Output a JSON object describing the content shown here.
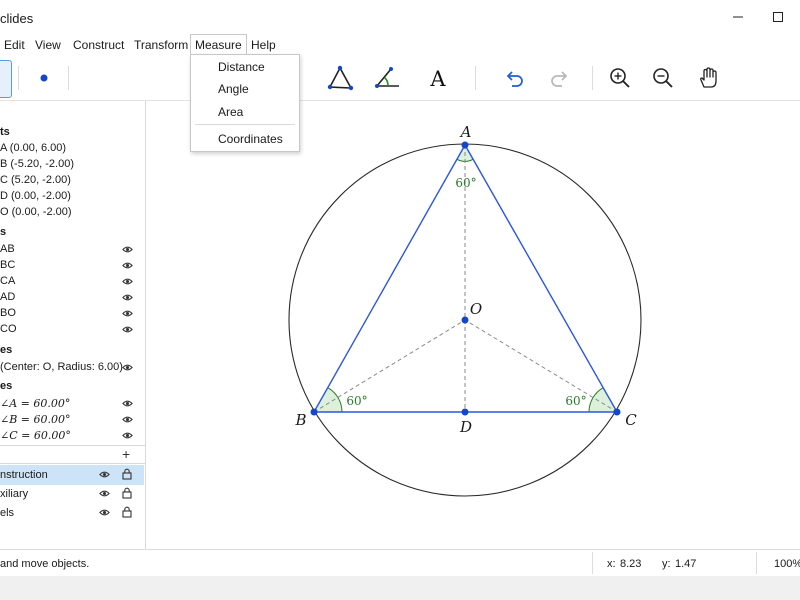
{
  "window": {
    "title": "clides",
    "minimize": "–",
    "maximize": "☐"
  },
  "menu": {
    "items": [
      "Edit",
      "View",
      "Construct",
      "Transform",
      "Measure",
      "Help"
    ]
  },
  "measure_menu": {
    "items": [
      "Distance",
      "Angle",
      "Area"
    ],
    "extra": "Coordinates"
  },
  "sidebar": {
    "points_header": "ts",
    "points": [
      "A  (0.00,  6.00)",
      "B  (-5.20, -2.00)",
      "C  (5.20, -2.00)",
      "D  (0.00, -2.00)",
      "O  (0.00, -2.00)"
    ],
    "segments_header": "s",
    "segments": [
      "AB",
      "BC",
      "CA",
      "AD",
      "BO",
      "CO"
    ],
    "circles_header": "es",
    "circle": " (Center: O, Radius: 6.00)",
    "angles_header": "es",
    "angles": [
      "∠A  =  60.00°",
      "∠B  =  60.00°",
      "∠C  =  60.00°"
    ],
    "layers_add": "+",
    "layers": [
      "nstruction",
      "xiliary",
      "els"
    ]
  },
  "canvas": {
    "labels": {
      "A": "A",
      "B": "B",
      "C": "C",
      "D": "D",
      "O": "O"
    },
    "angle_labels": [
      "60°",
      "60°",
      "60°"
    ],
    "stroke_color": "#2b56e0",
    "point_color": "#1446c8",
    "angle_fill": "#dcf0dc",
    "angle_text_color": "#2a7a2a"
  },
  "status": {
    "hint": "and move objects.",
    "x_label": "x:",
    "x_value": "8.23",
    "y_label": "y:",
    "y_value": "1.47",
    "zoom": "100%"
  }
}
